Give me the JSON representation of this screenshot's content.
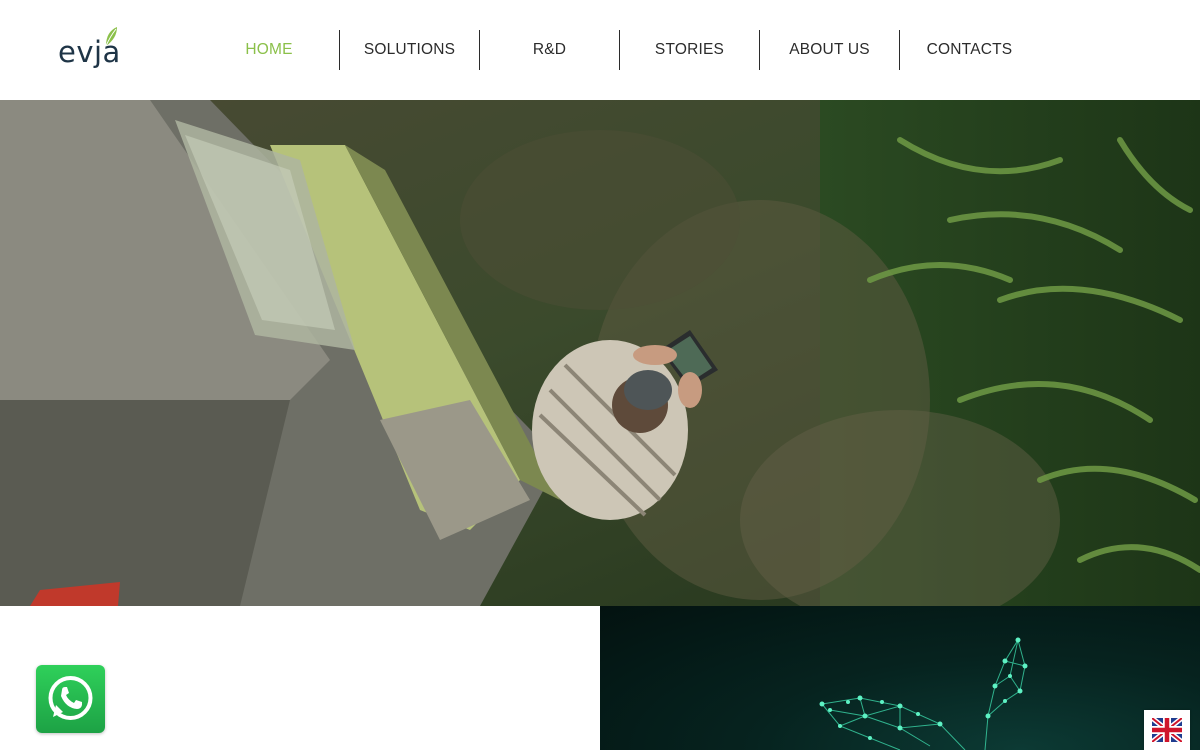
{
  "header": {
    "logo_text": "evja",
    "nav": [
      {
        "label": "HOME",
        "active": true
      },
      {
        "label": "SOLUTIONS",
        "active": false
      },
      {
        "label": "R&D",
        "active": false
      },
      {
        "label": "STORIES",
        "active": false
      },
      {
        "label": "ABOUT US",
        "active": false
      },
      {
        "label": "CONTACTS",
        "active": false
      }
    ]
  },
  "hero": {
    "image_subject": "aerial view of farmer with tablet beside harvester in a field"
  },
  "floating": {
    "whatsapp_icon": "whatsapp-icon",
    "language_icon": "uk-flag-icon"
  },
  "colors": {
    "brand_green": "#8bc04a",
    "logo_dark": "#1e3446",
    "nav_text": "#2b2b2b",
    "whatsapp_green": "#25d366",
    "panel_dark": "#06231f",
    "network_teal": "#3ee0b0"
  }
}
